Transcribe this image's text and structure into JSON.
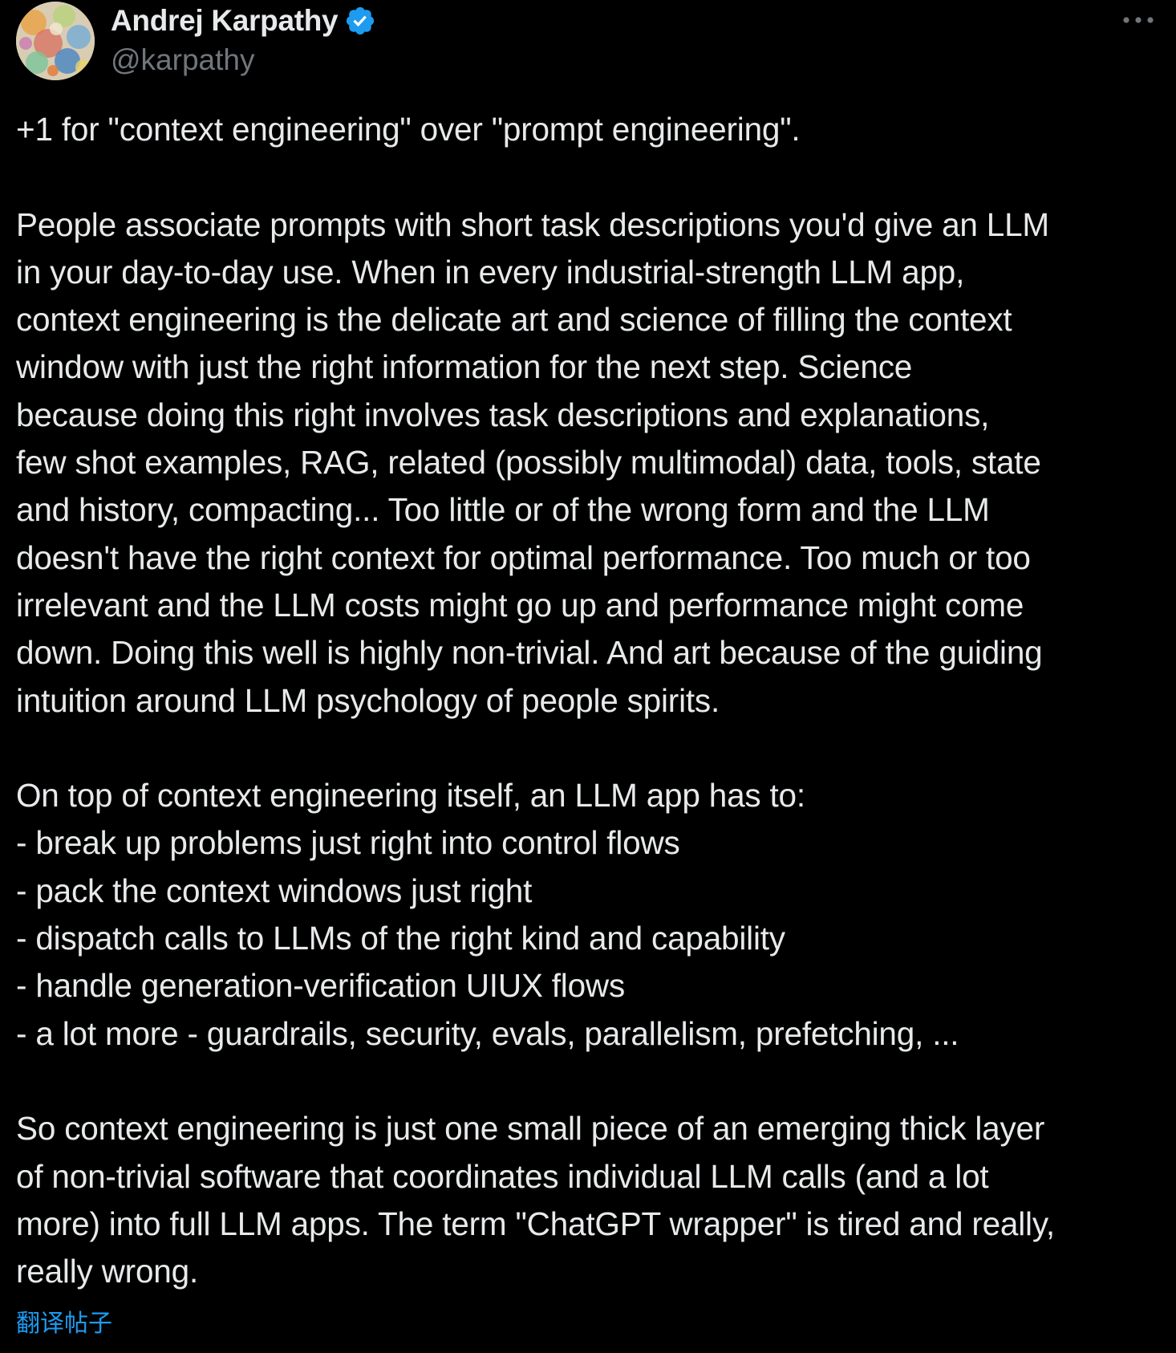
{
  "author": {
    "display_name": "Andrej Karpathy",
    "handle": "@karpathy",
    "verified": true,
    "avatar_icon": "avatar-image"
  },
  "menu": {
    "icon": "more-horizontal-icon"
  },
  "tweet": {
    "paragraphs": [
      "+1 for \"context engineering\" over \"prompt engineering\".",
      "",
      "People associate prompts with short task descriptions you'd give an LLM",
      "in your day-to-day use. When in every industrial-strength LLM app,",
      "context engineering is the delicate art and science of filling the context",
      "window with just the right information for the next step. Science",
      "because doing this right involves task descriptions and explanations,",
      "few shot examples, RAG, related (possibly multimodal) data, tools, state",
      "and history, compacting... Too little or of the wrong form and the LLM",
      "doesn't have the right context for optimal performance. Too much or too",
      "irrelevant and the LLM costs might go up and performance might come",
      "down. Doing this well is highly non-trivial. And art because of the guiding",
      "intuition around LLM psychology of people spirits.",
      "",
      "On top of context engineering itself, an LLM app has to:",
      "- break up problems just right into control flows",
      "- pack the context windows just right",
      "- dispatch calls to LLMs of the right kind and capability",
      "- handle generation-verification UIUX flows",
      "- a lot more - guardrails, security, evals, parallelism, prefetching, ...",
      "",
      "So context engineering is just one small piece of an emerging thick layer",
      "of non-trivial software that coordinates individual LLM calls (and a lot",
      "more) into full LLM apps. The term \"ChatGPT wrapper\" is tired and really,",
      "really wrong."
    ]
  },
  "translate_label": "翻译帖子",
  "colors": {
    "background": "#000000",
    "text": "#e7e9ea",
    "muted": "#71767b",
    "accent": "#1d9bf0"
  }
}
